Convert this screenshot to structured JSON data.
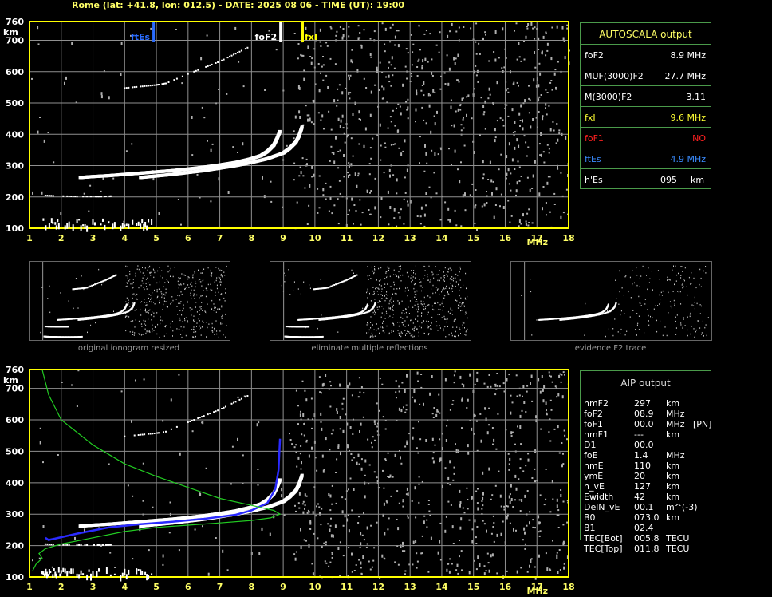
{
  "header": "Rome (lat: +41.8, lon: 012.5) - DATE: 2025 08 06 - TIME (UT): 19:00",
  "axes": {
    "xticks": [
      "1",
      "2",
      "3",
      "4",
      "5",
      "6",
      "7",
      "8",
      "9",
      "10",
      "11",
      "12",
      "13",
      "14",
      "15",
      "16",
      "17",
      "18"
    ],
    "yticks": [
      "100",
      "200",
      "300",
      "400",
      "500",
      "600",
      "700",
      "760"
    ],
    "yunit": "km",
    "xunit": "MHz"
  },
  "markers": {
    "ftEs": "ftEs",
    "foF2": "foF2",
    "fxI": "fxI"
  },
  "colors": {
    "axis": "#ffff00",
    "grid": "#909090",
    "trace": "#ffffff",
    "ftEs": "#2a6cff",
    "foF2": "#ffffff",
    "fxI": "#ffff00",
    "aip_profile": "#2a2aff",
    "model_profile": "#22cc22",
    "panel_border": "#4a9a4a"
  },
  "autoscala": {
    "title": "AUTOSCALA output",
    "rows": [
      {
        "label": "foF2",
        "value": "8.9 MHz",
        "color": "#ffffff"
      },
      {
        "label": "MUF(3000)F2",
        "value": "27.7 MHz",
        "color": "#ffffff"
      },
      {
        "label": "M(3000)F2",
        "value": "3.11",
        "color": "#ffffff"
      },
      {
        "label": "fxI",
        "value": "9.6 MHz",
        "color": "#ffff33"
      },
      {
        "label": "foF1",
        "value": "NO",
        "color": "#ff2020"
      },
      {
        "label": "ftEs",
        "value": "4.9 MHz",
        "color": "#3a8cff"
      },
      {
        "label": "h'Es",
        "value": "095",
        "unit": "km",
        "color": "#ffffff"
      }
    ]
  },
  "aip": {
    "title": "AIP output",
    "rows": [
      {
        "label": "hmF2",
        "value": "297",
        "unit": "km"
      },
      {
        "label": "foF2",
        "value": "08.9",
        "unit": "MHz"
      },
      {
        "label": "foF1",
        "value": "00.0",
        "unit": "MHz",
        "extra": "[PN]"
      },
      {
        "label": "hmF1",
        "value": "---",
        "unit": "km"
      },
      {
        "label": "D1",
        "value": "00.0",
        "unit": ""
      },
      {
        "label": "foE",
        "value": "1.4",
        "unit": "MHz"
      },
      {
        "label": "hmE",
        "value": "110",
        "unit": "km"
      },
      {
        "label": "ymE",
        "value": "20",
        "unit": "km"
      },
      {
        "label": "h_vE",
        "value": "127",
        "unit": "km"
      },
      {
        "label": "Ewidth",
        "value": "42",
        "unit": "km"
      },
      {
        "label": "DelN_vE",
        "value": "00.1",
        "unit": "m^(-3)"
      },
      {
        "label": "B0",
        "value": "073.0",
        "unit": "km"
      },
      {
        "label": "B1",
        "value": "02.4",
        "unit": ""
      },
      {
        "label": "TEC[Bot]",
        "value": "005.8",
        "unit": "TECU"
      },
      {
        "label": "TEC[Top]",
        "value": "011.8",
        "unit": "TECU"
      }
    ]
  },
  "captions": [
    "original ionogram resized",
    "eliminate multiple reflections",
    "evidence F2 trace"
  ],
  "chart_data": [
    {
      "type": "scatter",
      "title": "",
      "xlabel": "MHz",
      "ylabel": "km",
      "xlim": [
        1,
        18
      ],
      "ylim": [
        100,
        760
      ],
      "grid": true,
      "markers": [
        {
          "name": "ftEs",
          "x": 4.9
        },
        {
          "name": "foF2",
          "x": 8.9
        },
        {
          "name": "fxI",
          "x": 9.6
        }
      ],
      "series": [
        {
          "name": "F2 trace o-mode",
          "x": [
            2.6,
            3.0,
            3.5,
            4.0,
            4.5,
            5.0,
            5.5,
            6.0,
            6.5,
            7.0,
            7.5,
            8.0,
            8.3,
            8.5,
            8.7,
            8.8,
            8.9
          ],
          "y": [
            262,
            265,
            268,
            272,
            276,
            280,
            284,
            289,
            295,
            302,
            310,
            322,
            332,
            345,
            365,
            385,
            410
          ]
        },
        {
          "name": "F2 trace x-mode",
          "x": [
            4.5,
            5.0,
            5.5,
            6.0,
            6.5,
            7.0,
            7.5,
            8.0,
            8.5,
            9.0,
            9.2,
            9.4,
            9.5,
            9.6
          ],
          "y": [
            262,
            267,
            272,
            278,
            284,
            292,
            300,
            310,
            322,
            340,
            355,
            375,
            395,
            425
          ]
        },
        {
          "name": "Es trace",
          "x": [
            1.4,
            1.7,
            2.0,
            2.5,
            3.0,
            3.5,
            4.0,
            4.5,
            4.9
          ],
          "y": [
            110,
            108,
            107,
            107,
            106,
            106,
            106,
            107,
            108
          ]
        },
        {
          "name": "E trace",
          "x": [
            1.5,
            2.0,
            2.5,
            3.0,
            3.3,
            3.6
          ],
          "y": [
            202,
            200,
            199,
            199,
            199,
            200
          ]
        },
        {
          "name": "F2 multiple reflection",
          "x": [
            4.0,
            4.5,
            5.0,
            5.3,
            6.0,
            6.5,
            7.0,
            7.5,
            8.0
          ],
          "y": [
            545,
            550,
            555,
            560,
            590,
            610,
            630,
            655,
            680
          ]
        }
      ]
    },
    {
      "type": "line",
      "title": "",
      "xlabel": "MHz",
      "ylabel": "km",
      "xlim": [
        1,
        18
      ],
      "ylim": [
        100,
        760
      ],
      "grid": true,
      "series": [
        {
          "name": "AIP profile",
          "x": [
            1.5,
            1.6,
            1.8,
            2.5,
            3.5,
            4.5,
            5.5,
            6.5,
            7.5,
            8.0,
            8.5,
            8.75,
            8.85,
            8.9
          ],
          "y": [
            225,
            218,
            222,
            238,
            258,
            268,
            276,
            285,
            298,
            312,
            335,
            380,
            440,
            540
          ]
        },
        {
          "name": "model profile",
          "x": [
            1.1,
            1.2,
            1.4,
            1.3,
            1.5,
            2.0,
            3.0,
            4.0,
            5.0,
            6.0,
            7.0,
            8.0,
            8.6,
            8.9,
            8.7,
            8.0,
            7.0,
            6.0,
            5.0,
            4.0,
            3.0,
            2.0,
            1.6,
            1.4
          ],
          "y": [
            120,
            140,
            160,
            175,
            190,
            205,
            225,
            245,
            258,
            265,
            272,
            280,
            288,
            300,
            312,
            328,
            350,
            385,
            420,
            460,
            520,
            600,
            680,
            760
          ]
        }
      ]
    }
  ]
}
